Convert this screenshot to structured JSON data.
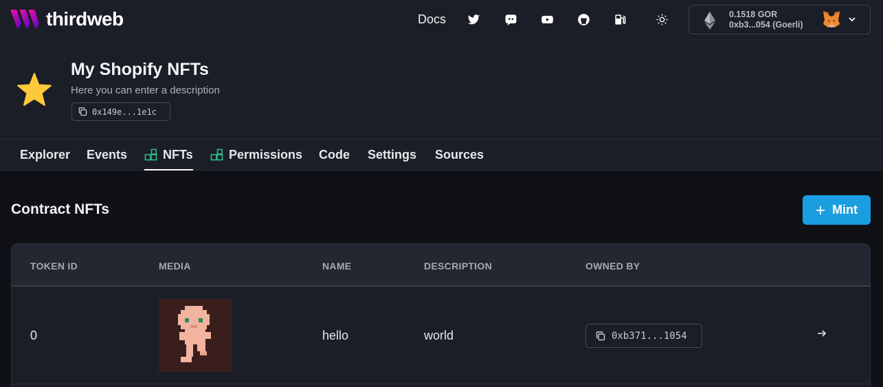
{
  "brand": {
    "name": "thirdweb"
  },
  "topnav": {
    "docs_label": "Docs",
    "icons": [
      "twitter-icon",
      "discord-icon",
      "youtube-icon",
      "github-icon",
      "gas-icon",
      "theme-toggle-icon"
    ]
  },
  "wallet": {
    "balance": "0.1518 GOR",
    "address": "0xb3...054 (Goerli)"
  },
  "contract": {
    "name": "My Shopify NFTs",
    "description": "Here you can enter a description",
    "address": "0x149e...1e1c"
  },
  "tabs": [
    {
      "label": "Explorer"
    },
    {
      "label": "Events"
    },
    {
      "label": "NFTs"
    },
    {
      "label": "Permissions"
    },
    {
      "label": "Code"
    },
    {
      "label": "Settings"
    },
    {
      "label": "Sources"
    }
  ],
  "active_tab": "NFTs",
  "section": {
    "title": "Contract NFTs",
    "mint_label": "Mint"
  },
  "table": {
    "columns": [
      "TOKEN ID",
      "MEDIA",
      "NAME",
      "DESCRIPTION",
      "OWNED BY"
    ],
    "rows": [
      {
        "token_id": "0",
        "name": "hello",
        "description": "world",
        "owner": "0xb371...1054"
      }
    ]
  },
  "colors": {
    "accent": "#1b9ee0",
    "brand": "#c735f5",
    "tab_icon": "#2bc48a",
    "background": "#0f1116",
    "surface": "#1b1e26"
  }
}
